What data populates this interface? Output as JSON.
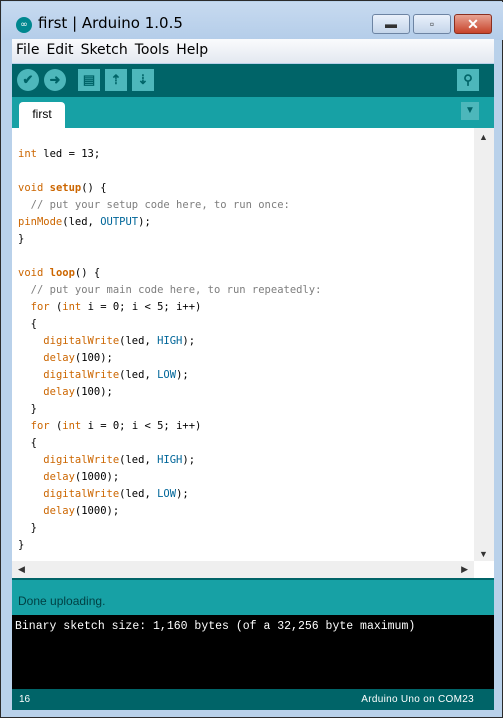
{
  "window": {
    "title": "first | Arduino 1.0.5",
    "app_icon": "arduino-logo-icon",
    "controls": {
      "minimize": "minimize-icon",
      "maximize": "maximize-icon",
      "close": "close-icon"
    }
  },
  "menubar": {
    "items": [
      "File",
      "Edit",
      "Sketch",
      "Tools",
      "Help"
    ]
  },
  "toolbar": {
    "buttons": [
      {
        "name": "verify",
        "icon": "checkmark-icon",
        "glyph": "✔"
      },
      {
        "name": "upload",
        "icon": "arrow-right-icon",
        "glyph": "➜"
      },
      {
        "name": "new",
        "icon": "new-file-icon",
        "glyph": "▤"
      },
      {
        "name": "open",
        "icon": "arrow-up-icon",
        "glyph": "⇡"
      },
      {
        "name": "save",
        "icon": "arrow-down-icon",
        "glyph": "⇣"
      }
    ],
    "serial_monitor": {
      "icon": "magnifier-icon",
      "glyph": "⚲"
    }
  },
  "tabs": {
    "items": [
      "first"
    ],
    "menu_glyph": "▼"
  },
  "editor": {
    "lines": [
      "int led = 13;",
      "",
      "void setup() {",
      "  // put your setup code here, to run once:",
      "pinMode(led, OUTPUT);",
      "}",
      "",
      "void loop() {",
      "  // put your main code here, to run repeatedly:",
      "  for (int i = 0; i < 5; i++)",
      "  {",
      "    digitalWrite(led, HIGH);",
      "    delay(100);",
      "    digitalWrite(led, LOW);",
      "    delay(100);",
      "  }",
      "  for (int i = 0; i < 5; i++)",
      "  {",
      "    digitalWrite(led, HIGH);",
      "    delay(1000);",
      "    digitalWrite(led, LOW);",
      "    delay(1000);",
      "  }",
      "}"
    ],
    "syntax_colors": {
      "keyword": "#cc6600",
      "comment": "#7e7e7e",
      "constant": "#006699"
    }
  },
  "status": {
    "message": "Done uploading."
  },
  "console": {
    "output": "Binary sketch size: 1,160 bytes (of a 32,256 byte maximum)"
  },
  "footer": {
    "line_number": "16",
    "board": "Arduino Uno on COM23"
  },
  "colors": {
    "toolbar": "#006468",
    "tabbar": "#17a1a5",
    "console_bg": "#000000"
  }
}
